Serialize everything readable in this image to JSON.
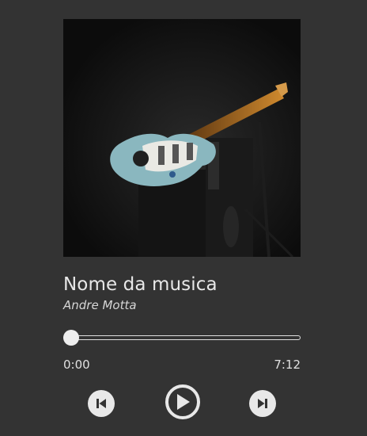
{
  "track": {
    "title": "Nome da musica",
    "artist": "Andre Motta",
    "cover_alt": "Electric guitar on amplifier in dark room"
  },
  "progress": {
    "current_time": "0:00",
    "duration": "7:12",
    "fraction": 0.0
  },
  "controls": {
    "previous_icon": "skip-previous-icon",
    "play_icon": "play-icon",
    "next_icon": "skip-next-icon"
  },
  "colors": {
    "background": "#333333",
    "accent": "#e8e8e8"
  }
}
